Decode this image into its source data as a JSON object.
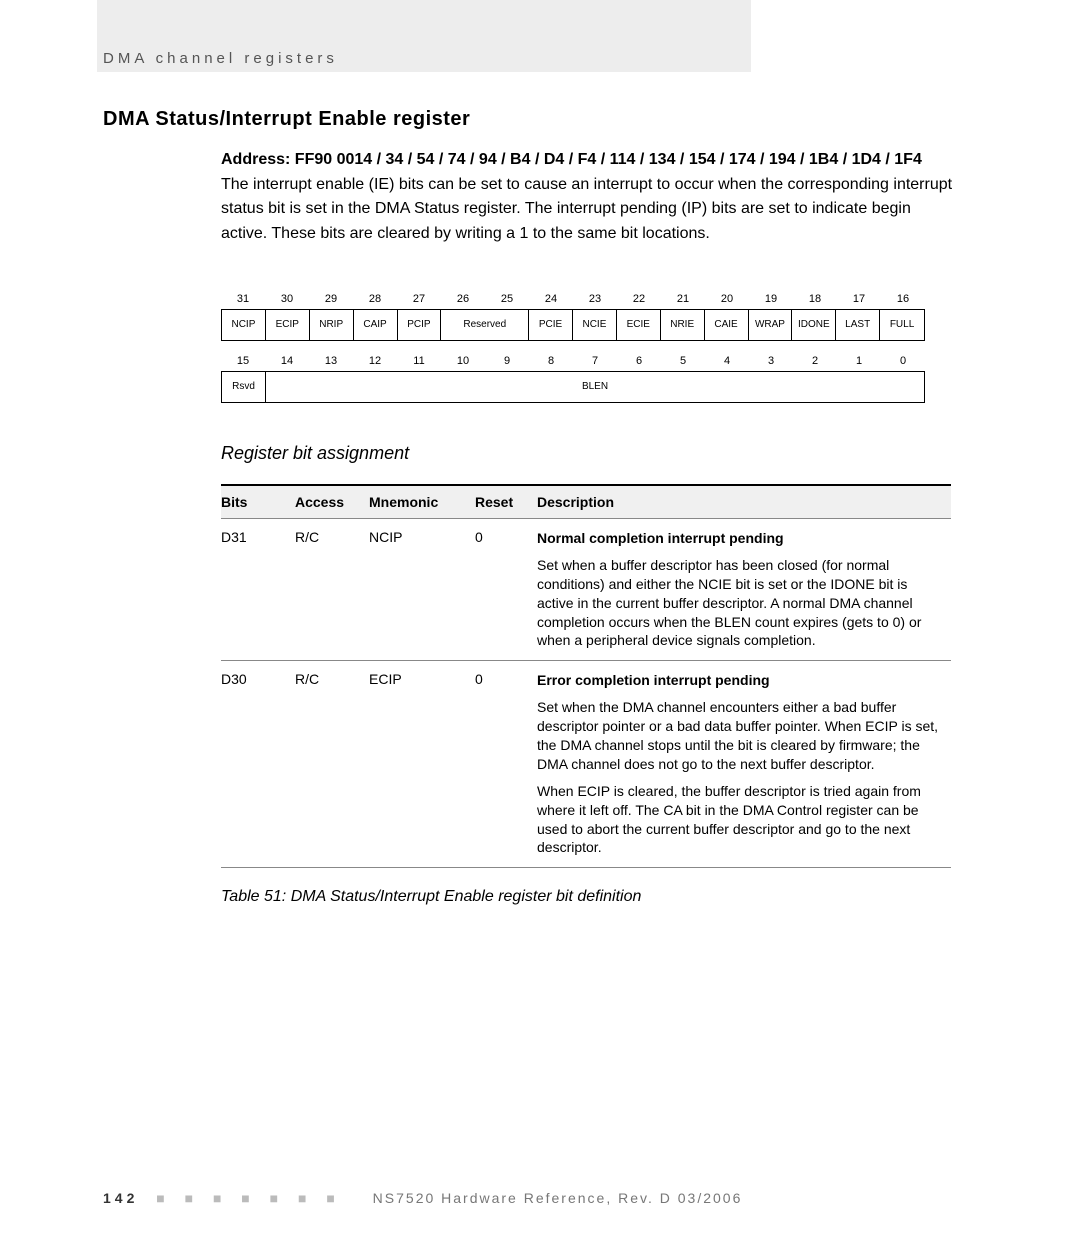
{
  "running_head": "DMA channel registers",
  "section_title": "DMA Status/Interrupt Enable register",
  "address_line": "Address: FF90 0014 / 34 / 54 / 74 / 94 / B4 / D4 / F4 / 114 / 134 / 154 / 174 / 194 / 1B4 / 1D4 / 1F4",
  "intro_para": "The interrupt enable (IE) bits can be set to cause an interrupt to occur when the corresponding interrupt status bit is set in the DMA Status register. The interrupt pending (IP) bits are set to indicate begin active. These bits are cleared by writing a 1 to the same bit locations.",
  "bits_high": {
    "nums": [
      "31",
      "30",
      "29",
      "28",
      "27",
      "26",
      "25",
      "24",
      "23",
      "22",
      "21",
      "20",
      "19",
      "18",
      "17",
      "16"
    ],
    "cells": [
      {
        "label": "NCIP",
        "w": "w1"
      },
      {
        "label": "ECIP",
        "w": "w1"
      },
      {
        "label": "NRIP",
        "w": "w1"
      },
      {
        "label": "CAIP",
        "w": "w1"
      },
      {
        "label": "PCIP",
        "w": "w1"
      },
      {
        "label": "Reserved",
        "w": "w2"
      },
      {
        "label": "PCIE",
        "w": "w1"
      },
      {
        "label": "NCIE",
        "w": "w1"
      },
      {
        "label": "ECIE",
        "w": "w1"
      },
      {
        "label": "NRIE",
        "w": "w1"
      },
      {
        "label": "CAIE",
        "w": "w1"
      },
      {
        "label": "WRAP",
        "w": "w1"
      },
      {
        "label": "IDONE",
        "w": "w1"
      },
      {
        "label": "LAST",
        "w": "w1"
      },
      {
        "label": "FULL",
        "w": "w1"
      }
    ]
  },
  "bits_low": {
    "nums": [
      "15",
      "14",
      "13",
      "12",
      "11",
      "10",
      "9",
      "8",
      "7",
      "6",
      "5",
      "4",
      "3",
      "2",
      "1",
      "0"
    ],
    "cells": [
      {
        "label": "Rsvd",
        "w": "w1"
      },
      {
        "label": "BLEN",
        "w": "w15"
      }
    ]
  },
  "subheading": "Register bit assignment",
  "table": {
    "headers": {
      "bits": "Bits",
      "access": "Access",
      "mnemonic": "Mnemonic",
      "reset": "Reset",
      "description": "Description"
    },
    "rows": [
      {
        "bits": "D31",
        "access": "R/C",
        "mnemonic": "NCIP",
        "reset": "0",
        "title": "Normal completion interrupt pending",
        "paras": [
          "Set when a buffer descriptor has been closed (for normal conditions) and either the NCIE bit is set or the IDONE bit is active in the current buffer descriptor. A normal DMA channel completion occurs when the BLEN count expires (gets to 0) or when a peripheral device signals completion."
        ]
      },
      {
        "bits": "D30",
        "access": "R/C",
        "mnemonic": "ECIP",
        "reset": "0",
        "title": "Error completion interrupt pending",
        "paras": [
          "Set when the DMA channel encounters either a bad buffer descriptor pointer or a bad data buffer pointer. When ECIP is set, the DMA channel stops until the bit is cleared by firmware; the DMA channel does not go to the next buffer descriptor.",
          "When ECIP is cleared, the buffer descriptor is tried again from where it left off. The CA bit in the DMA Control register can be used to abort the current buffer descriptor and go to the next descriptor."
        ]
      }
    ]
  },
  "caption": "Table 51: DMA Status/Interrupt Enable register bit definition",
  "footer": {
    "page_num": "142",
    "dots": "■ ■ ■ ■ ■ ■ ■",
    "doc": "NS7520 Hardware Reference, Rev. D 03/2006"
  }
}
